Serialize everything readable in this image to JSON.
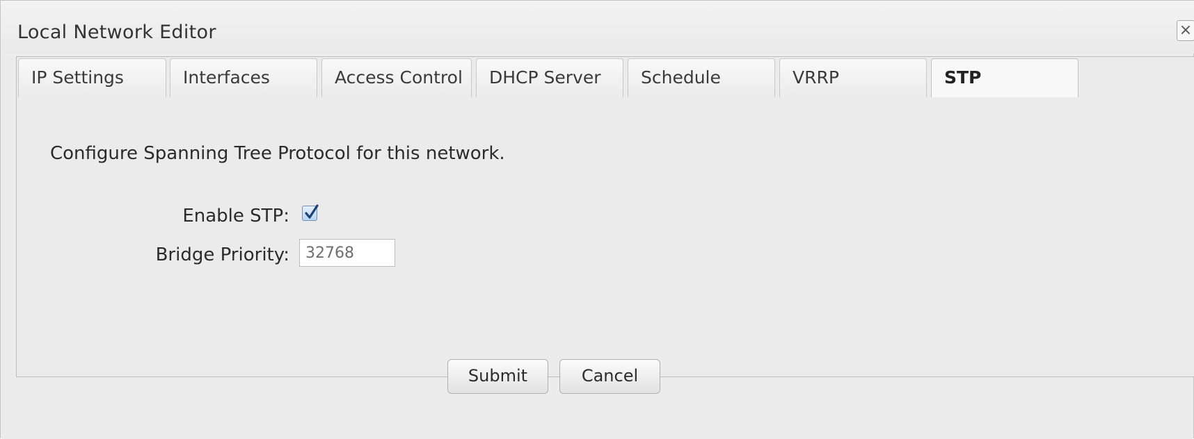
{
  "dialog": {
    "title": "Local Network Editor",
    "close_label": "×"
  },
  "tabs": [
    {
      "label": "IP Settings"
    },
    {
      "label": "Interfaces"
    },
    {
      "label": "Access Control"
    },
    {
      "label": "DHCP Server"
    },
    {
      "label": "Schedule"
    },
    {
      "label": "VRRP"
    },
    {
      "label": "STP",
      "active": true
    }
  ],
  "stp": {
    "description": "Configure Spanning Tree Protocol for this network.",
    "enable_label": "Enable STP:",
    "enable_checked": true,
    "bridge_priority_label": "Bridge Priority:",
    "bridge_priority_value": "32768"
  },
  "footer": {
    "submit_label": "Submit",
    "cancel_label": "Cancel"
  },
  "colors": {
    "checkbox_accent": "#3b6eb4",
    "background": "#ebebeb"
  }
}
